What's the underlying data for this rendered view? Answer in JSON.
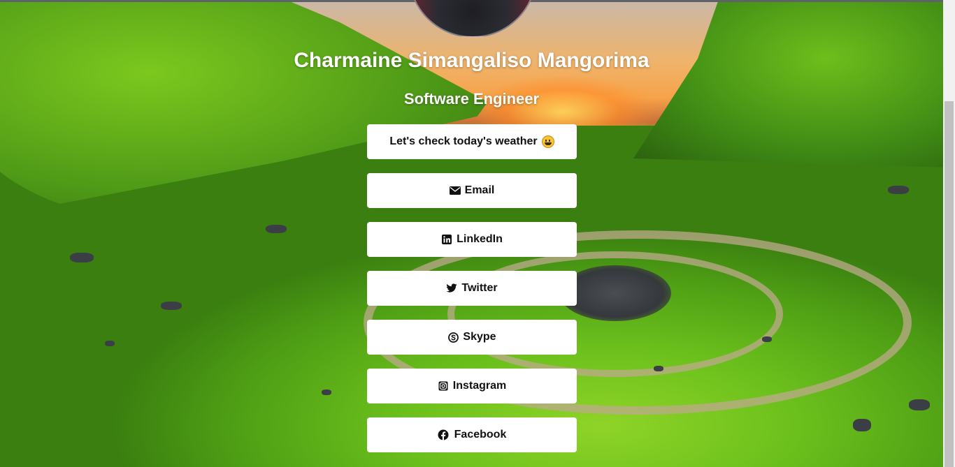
{
  "profile": {
    "name": "Charmaine Simangaliso Mangorima",
    "title": "Software Engineer"
  },
  "links": [
    {
      "label": "Let's check today's weather",
      "icon": "grinning-face-emoji"
    },
    {
      "label": "Email",
      "icon": "envelope-icon"
    },
    {
      "label": "LinkedIn",
      "icon": "linkedin-icon"
    },
    {
      "label": "Twitter",
      "icon": "twitter-icon"
    },
    {
      "label": "Skype",
      "icon": "skype-icon"
    },
    {
      "label": "Instagram",
      "icon": "instagram-icon"
    },
    {
      "label": "Facebook",
      "icon": "facebook-icon"
    }
  ],
  "colors": {
    "button_bg": "#ffffff",
    "button_text": "#111111",
    "heading_text": "#ffffff"
  }
}
